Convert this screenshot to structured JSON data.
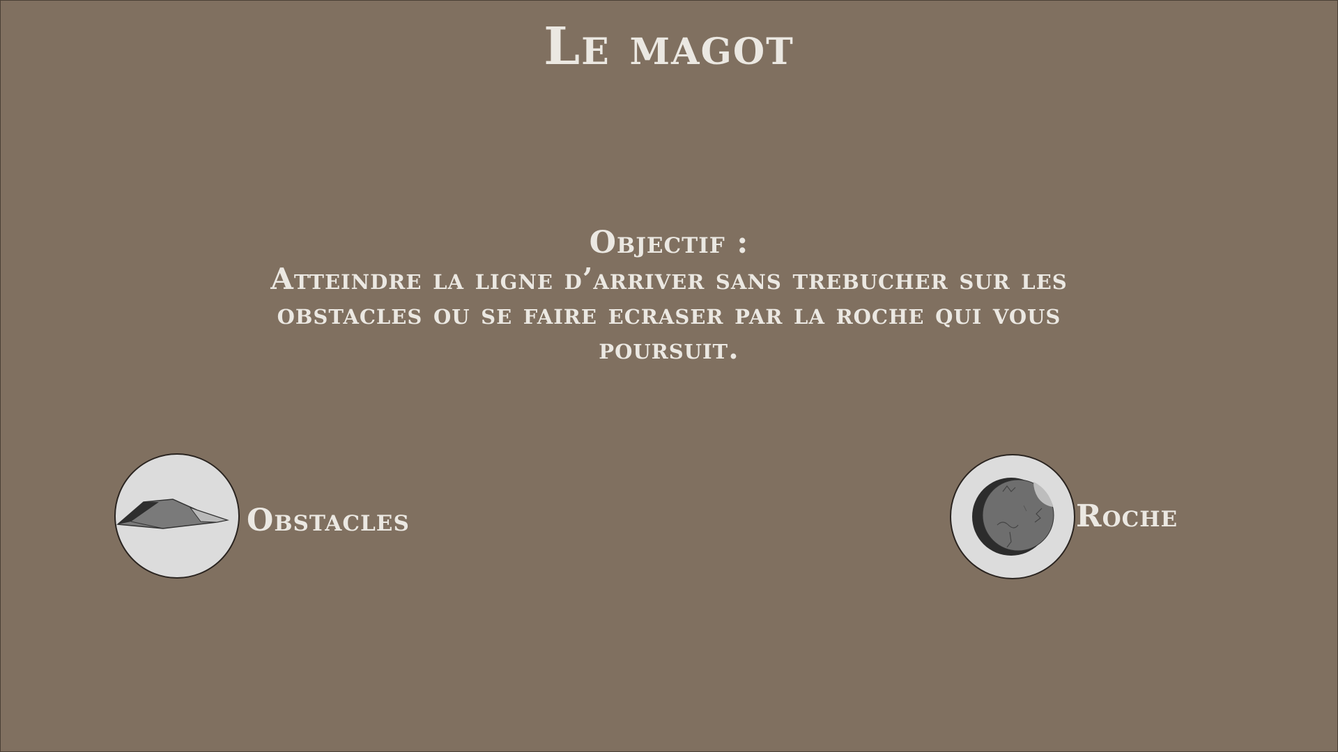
{
  "game": {
    "title": "Le magot"
  },
  "objective": {
    "heading": "Objectif :",
    "text": "Atteindre la ligne d’arriver sans trebucher sur les obstacles ou se faire ecraser par la roche qui vous poursuit."
  },
  "legend": [
    {
      "label": "Obstacles",
      "icon": "rock-shard-icon"
    },
    {
      "label": "Roche",
      "icon": "boulder-icon"
    }
  ],
  "colors": {
    "background": "#807060",
    "text": "#ebe8e2",
    "icon_background": "#dcdcdc"
  }
}
